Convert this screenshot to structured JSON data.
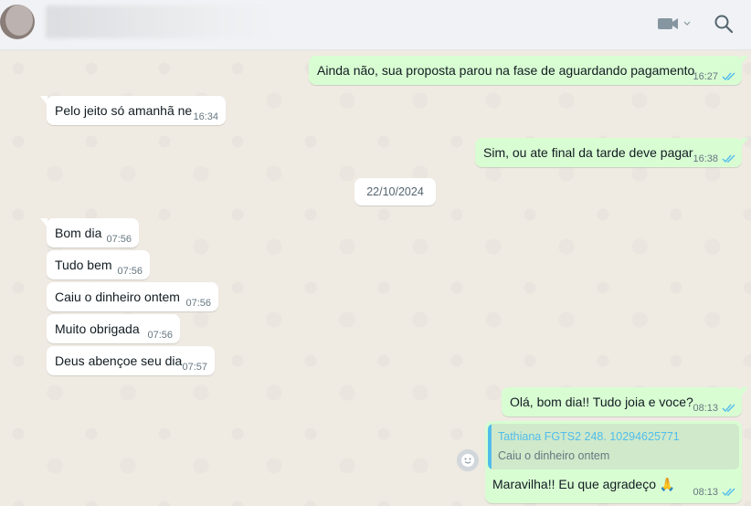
{
  "header": {
    "video_icon": "video-camera-icon",
    "search_icon": "search-icon"
  },
  "messages": [
    {
      "direction": "out",
      "text": "Ainda não, sua proposta parou na fase de aguardando pagamento",
      "time": "16:27",
      "status": "read"
    },
    {
      "direction": "in",
      "text": "Pelo jeito só amanhã ne",
      "time": "16:34"
    },
    {
      "direction": "out",
      "text": "Sim, ou ate final da tarde deve pagar",
      "time": "16:38",
      "status": "read"
    },
    {
      "direction": "in",
      "text": "Bom dia",
      "time": "07:56"
    },
    {
      "direction": "in",
      "text": "Tudo bem",
      "time": "07:56"
    },
    {
      "direction": "in",
      "text": "Caiu o dinheiro ontem",
      "time": "07:56"
    },
    {
      "direction": "in",
      "text": "Muito obrigada",
      "time": "07:56"
    },
    {
      "direction": "in",
      "text": "Deus abençoe seu dia",
      "time": "07:57"
    },
    {
      "direction": "out",
      "text": "Olá, bom dia!! Tudo joia e voce?",
      "time": "08:13",
      "status": "read"
    }
  ],
  "date_separator": "22/10/2024",
  "reply_message": {
    "quote_author": "Tathiana FGTS2 248. 10294625771",
    "quote_text": "Caiu o dinheiro ontem",
    "text": "Maravilha!! Eu que agradeço",
    "emoji": "🙏",
    "time": "08:13",
    "status": "read"
  },
  "colors": {
    "outgoing_bubble": "#d9fdd3",
    "incoming_bubble": "#ffffff",
    "chat_background": "#efeae2",
    "read_ticks": "#53bdeb"
  }
}
